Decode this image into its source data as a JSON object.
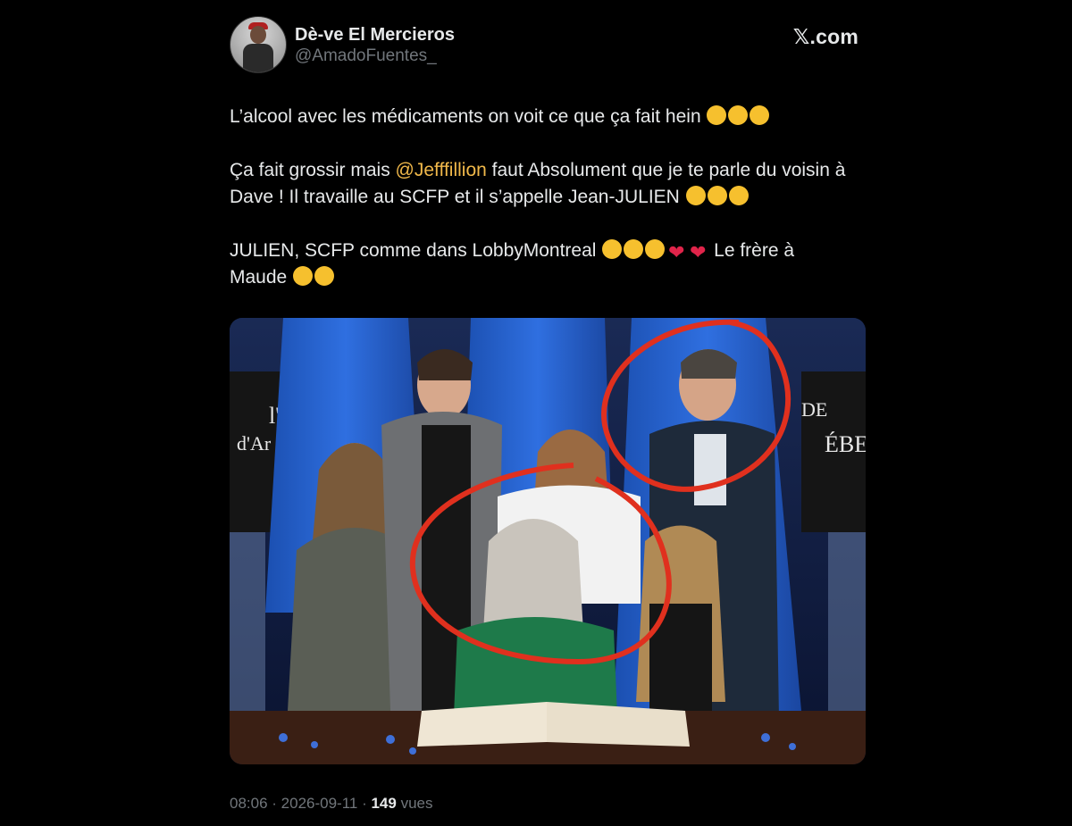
{
  "author": {
    "display_name": "Dè-ve El Mercieros",
    "handle": "@AmadoFuentes_"
  },
  "brand": "𝕏.com",
  "tweet": {
    "line1": "L’alcool avec les médicaments on voit ce que ça fait hein",
    "line1_emojis": [
      "winking-face",
      "face-with-tears-of-joy",
      "face-with-tears-of-joy"
    ],
    "p2_before": "Ça fait grossir mais ",
    "mention": "@Jefffillion",
    "p2_after": " faut Absolument que je te parle du voisin à Dave ! Il travaille au SCFP et il s’appelle Jean-JULIEN",
    "p2_emojis": [
      "face-with-tears-of-joy",
      "face-with-tears-of-joy",
      "face-with-tears-of-joy"
    ],
    "p3_before": "JULIEN, SCFP comme dans LobbyMontreal",
    "p3_emojis": [
      "heart-eyes",
      "heart-eyes",
      "heart-eyes",
      "heart-on-fire",
      "heart-on-fire"
    ],
    "p3_middle": " Le frère à Maude",
    "p3_end_emojis": [
      "heart-eyes",
      "heart-eyes"
    ]
  },
  "photo": {
    "sign_left": "l'\nd'Ar",
    "sign_right": "DE\nÉBE",
    "annotation_color": "#e0301e"
  },
  "meta": {
    "time": "08:06",
    "separator": " · ",
    "date": "2026-09-11",
    "views_count": "149",
    "views_label": " vues"
  }
}
